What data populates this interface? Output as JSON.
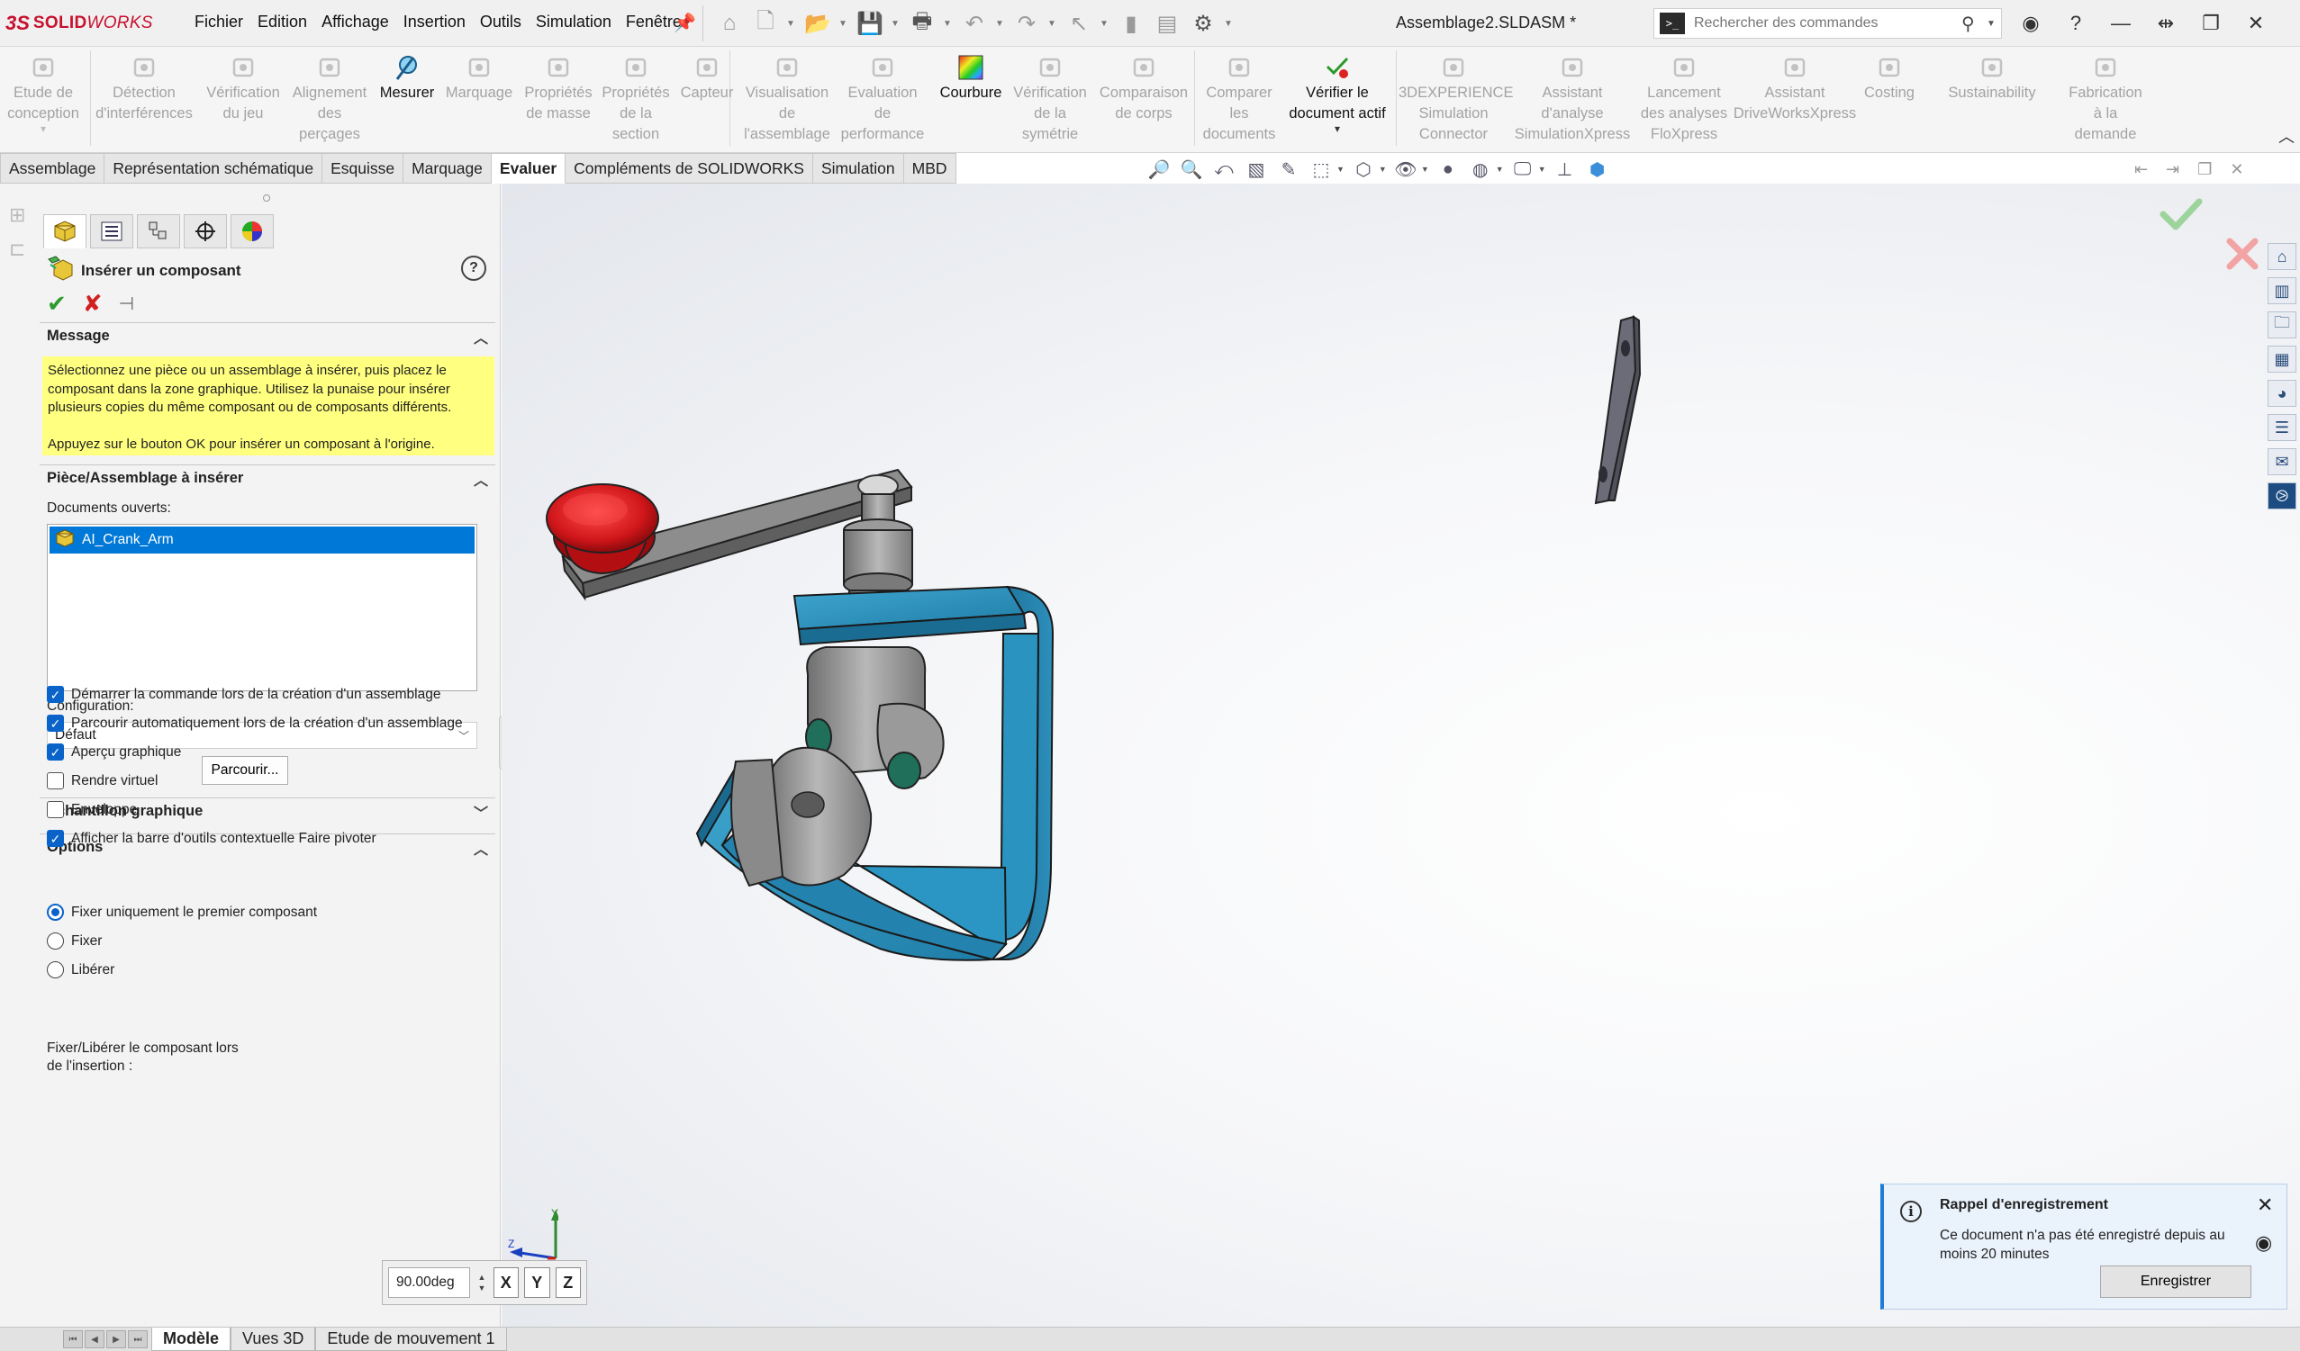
{
  "app": {
    "brand_prefix": "3S",
    "brand_name_bold": "SOLID",
    "brand_name_italic": "WORKS",
    "document_title": "Assemblage2.SLDASM *"
  },
  "menu": [
    "Fichier",
    "Edition",
    "Affichage",
    "Insertion",
    "Outils",
    "Simulation",
    "Fenêtre"
  ],
  "search": {
    "placeholder": "Rechercher des commandes"
  },
  "ribbon": {
    "buttons": [
      {
        "label": "Etude de\nconception",
        "state": "disabled",
        "icon": "design-study-icon"
      },
      {
        "label": "Détection\nd'interférences",
        "state": "disabled",
        "icon": "interference-icon"
      },
      {
        "label": "Vérification\ndu jeu",
        "state": "disabled",
        "icon": "clearance-icon"
      },
      {
        "label": "Alignement\ndes\nperçages",
        "state": "disabled",
        "icon": "hole-alignment-icon"
      },
      {
        "label": "Mesurer",
        "state": "enabled",
        "icon": "measure-icon"
      },
      {
        "label": "Marquage",
        "state": "disabled",
        "icon": "markup-icon"
      },
      {
        "label": "Propriétés\nde masse",
        "state": "disabled",
        "icon": "mass-properties-icon"
      },
      {
        "label": "Propriétés\nde la\nsection",
        "state": "disabled",
        "icon": "section-properties-icon"
      },
      {
        "label": "Capteur",
        "state": "disabled",
        "icon": "sensor-icon"
      },
      {
        "label": "Visualisation\nde\nl'assemblage",
        "state": "disabled",
        "icon": "assembly-visualization-icon"
      },
      {
        "label": "Evaluation\nde\nperformance",
        "state": "disabled",
        "icon": "performance-icon"
      },
      {
        "label": "Courbure",
        "state": "enabled",
        "icon": "curvature-icon"
      },
      {
        "label": "Vérification\nde la\nsymétrie",
        "state": "disabled",
        "icon": "symmetry-icon"
      },
      {
        "label": "Comparaison\nde corps",
        "state": "disabled",
        "icon": "compare-bodies-icon"
      },
      {
        "label": "Comparer\nles\ndocuments",
        "state": "disabled",
        "icon": "compare-documents-icon"
      },
      {
        "label": "Vérifier le\ndocument actif",
        "state": "enabled",
        "icon": "check-active-document-icon"
      },
      {
        "label": "3DEXPERIENCE\nSimulation\nConnector",
        "state": "disabled",
        "icon": "3dx-simulation-icon"
      },
      {
        "label": "Assistant\nd'analyse\nSimulationXpress",
        "state": "disabled",
        "icon": "simulationxpress-icon"
      },
      {
        "label": "Lancement\ndes analyses\nFloXpress",
        "state": "disabled",
        "icon": "floxpress-icon"
      },
      {
        "label": "Assistant\nDriveWorksXpress",
        "state": "disabled",
        "icon": "driveworksxpress-icon"
      },
      {
        "label": "Costing",
        "state": "disabled",
        "icon": "costing-icon"
      },
      {
        "label": "Sustainability",
        "state": "disabled",
        "icon": "sustainability-icon"
      },
      {
        "label": "Fabrication\nà la\ndemande",
        "state": "disabled",
        "icon": "manufacturing-icon"
      }
    ]
  },
  "tabs": [
    "Assemblage",
    "Représentation schématique",
    "Esquisse",
    "Marquage",
    "Evaluer",
    "Compléments de SOLIDWORKS",
    "Simulation",
    "MBD"
  ],
  "active_tab": "Evaluer",
  "property_manager": {
    "title": "Insérer un composant",
    "message": {
      "header": "Message",
      "text1": "Sélectionnez une pièce ou un assemblage à insérer, puis placez le composant dans la zone graphique. Utilisez la punaise pour insérer plusieurs copies du même composant ou de composants différents.",
      "text2": "Appuyez sur le bouton OK pour insérer un composant à l'origine."
    },
    "insert_section": {
      "header": "Pièce/Assemblage à insérer",
      "open_docs_label": "Documents ouverts:",
      "open_docs": [
        "AI_Crank_Arm"
      ],
      "config_label": "Configuration:",
      "config_value": "Défaut",
      "browse_label": "Parcourir..."
    },
    "thumbnail_header": "Echantillon graphique",
    "options": {
      "header": "Options",
      "checkboxes": [
        {
          "label": "Démarrer la commande lors de la création d'un assemblage",
          "checked": true
        },
        {
          "label": "Parcourir automatiquement lors de la création d'un assemblage",
          "checked": true
        },
        {
          "label": "Aperçu graphique",
          "checked": true
        },
        {
          "label": "Rendre virtuel",
          "checked": false
        },
        {
          "label": "Enveloppe",
          "checked": false
        },
        {
          "label": "Afficher la barre d'outils contextuelle Faire pivoter",
          "checked": true
        }
      ],
      "fix_label_1": "Fixer/Libérer le composant lors",
      "fix_label_2": "de l'insertion :",
      "radios": [
        {
          "label": "Fixer uniquement le premier composant",
          "selected": true
        },
        {
          "label": "Fixer",
          "selected": false
        },
        {
          "label": "Libérer",
          "selected": false
        }
      ]
    }
  },
  "rotate_box": {
    "value": "90.00deg",
    "axes": [
      "X",
      "Y",
      "Z"
    ]
  },
  "triad": {
    "y": "Y",
    "z": "Z"
  },
  "notification": {
    "title": "Rappel d'enregistrement",
    "body": "Ce document n'a pas été enregistré depuis au moins 20 minutes",
    "button": "Enregistrer"
  },
  "bottom_tabs": [
    "Modèle",
    "Vues 3D",
    "Etude de mouvement 1"
  ],
  "active_bottom_tab": "Modèle",
  "colors": {
    "clamp_blue": "#2a8fba",
    "knob_red": "#d0161a",
    "steel_gray": "#8c8c8c",
    "accent_blue": "#0078d7",
    "message_yellow": "#ffff80"
  }
}
